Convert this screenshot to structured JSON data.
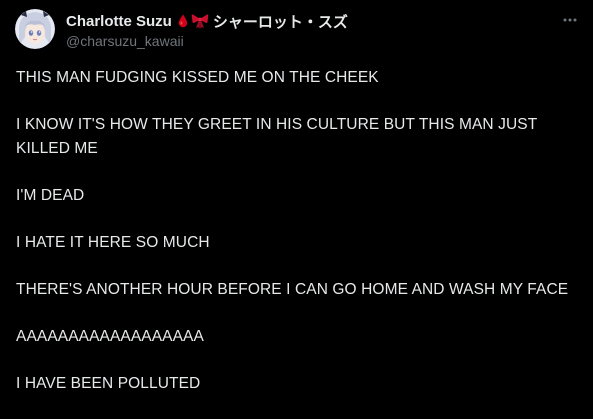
{
  "post": {
    "author": {
      "display_name": "Charlotte Suzu",
      "name_emojis": [
        "blood-drop-icon",
        "ribbon-icon"
      ],
      "name_suffix": "シャーロット・スズ",
      "handle": "@charsuzu_kawaii"
    },
    "more_icon": "more-horizontal-icon",
    "paragraphs": [
      "THIS MAN FUDGING KISSED ME ON THE CHEEK",
      "I KNOW IT'S HOW THEY GREET IN HIS CULTURE BUT THIS MAN JUST KILLED ME",
      "I'M DEAD",
      "I HATE IT HERE SO MUCH",
      "THERE'S ANOTHER HOUR BEFORE I CAN GO HOME AND WASH MY FACE",
      "AAAAAAAAAAAAAAAAAA",
      "I HAVE BEEN POLLUTED"
    ]
  },
  "colors": {
    "background": "#000000",
    "text": "#e7e9ea",
    "secondary_text": "#71767b",
    "blood": "#d0021b",
    "ribbon": "#c8102e"
  }
}
